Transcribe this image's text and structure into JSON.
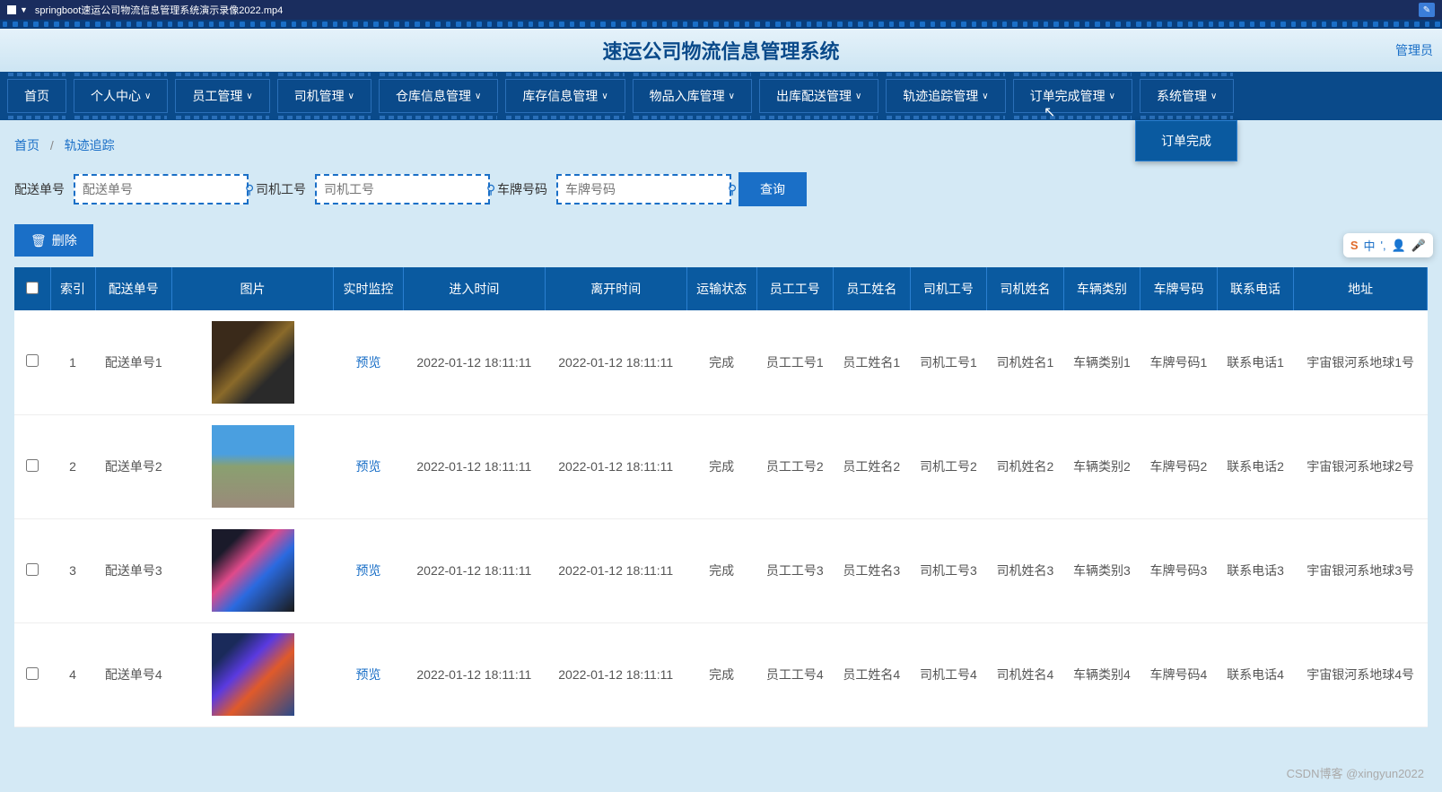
{
  "titlebar": {
    "filename": "springboot速运公司物流信息管理系统演示录像2022.mp4"
  },
  "header": {
    "title": "速运公司物流信息管理系统",
    "user": "管理员"
  },
  "nav": {
    "items": [
      {
        "label": "首页",
        "has_sub": false
      },
      {
        "label": "个人中心",
        "has_sub": true
      },
      {
        "label": "员工管理",
        "has_sub": true
      },
      {
        "label": "司机管理",
        "has_sub": true
      },
      {
        "label": "仓库信息管理",
        "has_sub": true
      },
      {
        "label": "库存信息管理",
        "has_sub": true
      },
      {
        "label": "物品入库管理",
        "has_sub": true
      },
      {
        "label": "出库配送管理",
        "has_sub": true
      },
      {
        "label": "轨迹追踪管理",
        "has_sub": true
      },
      {
        "label": "订单完成管理",
        "has_sub": true
      },
      {
        "label": "系统管理",
        "has_sub": true
      }
    ],
    "dropdown": "订单完成"
  },
  "breadcrumb": {
    "home": "首页",
    "current": "轨迹追踪"
  },
  "search": {
    "fields": [
      {
        "label": "配送单号",
        "placeholder": "配送单号"
      },
      {
        "label": "司机工号",
        "placeholder": "司机工号"
      },
      {
        "label": "车牌号码",
        "placeholder": "车牌号码"
      }
    ],
    "query_btn": "查询"
  },
  "actions": {
    "delete": "删除"
  },
  "table": {
    "headers": [
      "",
      "索引",
      "配送单号",
      "图片",
      "实时监控",
      "进入时间",
      "离开时间",
      "运输状态",
      "员工工号",
      "员工姓名",
      "司机工号",
      "司机姓名",
      "车辆类别",
      "车牌号码",
      "联系电话",
      "地址"
    ],
    "rows": [
      {
        "idx": "1",
        "order": "配送单号1",
        "img_class": "img1",
        "monitor": "预览",
        "enter": "2022-01-12 18:11:11",
        "leave": "2022-01-12 18:11:11",
        "status": "完成",
        "emp_id": "员工工号1",
        "emp_name": "员工姓名1",
        "drv_id": "司机工号1",
        "drv_name": "司机姓名1",
        "veh_type": "车辆类别1",
        "plate": "车牌号码1",
        "phone": "联系电话1",
        "addr": "宇宙银河系地球1号"
      },
      {
        "idx": "2",
        "order": "配送单号2",
        "img_class": "img2",
        "monitor": "预览",
        "enter": "2022-01-12 18:11:11",
        "leave": "2022-01-12 18:11:11",
        "status": "完成",
        "emp_id": "员工工号2",
        "emp_name": "员工姓名2",
        "drv_id": "司机工号2",
        "drv_name": "司机姓名2",
        "veh_type": "车辆类别2",
        "plate": "车牌号码2",
        "phone": "联系电话2",
        "addr": "宇宙银河系地球2号"
      },
      {
        "idx": "3",
        "order": "配送单号3",
        "img_class": "img3",
        "monitor": "预览",
        "enter": "2022-01-12 18:11:11",
        "leave": "2022-01-12 18:11:11",
        "status": "完成",
        "emp_id": "员工工号3",
        "emp_name": "员工姓名3",
        "drv_id": "司机工号3",
        "drv_name": "司机姓名3",
        "veh_type": "车辆类别3",
        "plate": "车牌号码3",
        "phone": "联系电话3",
        "addr": "宇宙银河系地球3号"
      },
      {
        "idx": "4",
        "order": "配送单号4",
        "img_class": "img4",
        "monitor": "预览",
        "enter": "2022-01-12 18:11:11",
        "leave": "2022-01-12 18:11:11",
        "status": "完成",
        "emp_id": "员工工号4",
        "emp_name": "员工姓名4",
        "drv_id": "司机工号4",
        "drv_name": "司机姓名4",
        "veh_type": "车辆类别4",
        "plate": "车牌号码4",
        "phone": "联系电话4",
        "addr": "宇宙银河系地球4号"
      }
    ]
  },
  "floater": {
    "ime": "中",
    "dots": "',"
  },
  "watermark": "CSDN博客 @xingyun2022"
}
